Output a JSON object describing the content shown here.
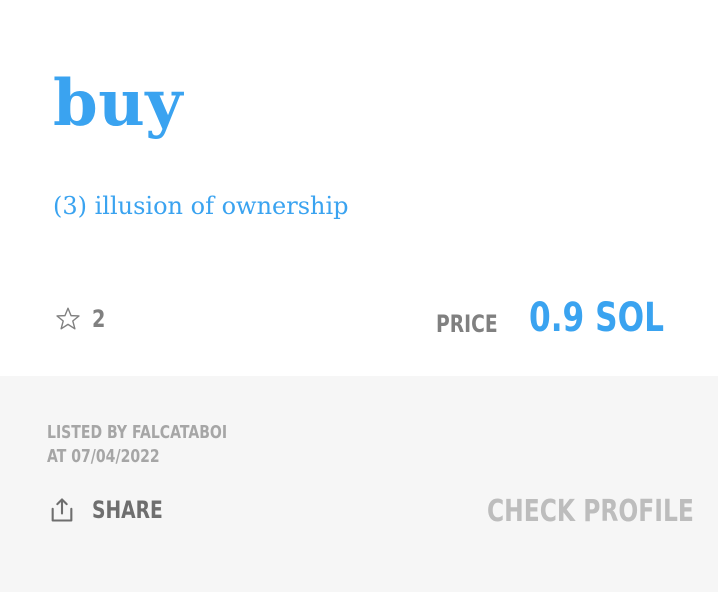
{
  "word": {
    "title": "buy",
    "definition": "(3) illusion of ownership"
  },
  "favorites": {
    "icon": "star-outline-icon",
    "count": "2"
  },
  "price": {
    "label": "PRICE",
    "value": "0.9 SOL"
  },
  "listing": {
    "listed_by": "LISTED BY FALCATABOI",
    "listed_at": "AT 07/04/2022"
  },
  "actions": {
    "share_icon": "share-icon",
    "share_label": "SHARE",
    "check_profile_label": "CHECK PROFILE"
  },
  "colors": {
    "accent": "#3aa3f0",
    "muted_text": "#808080",
    "footer_bg": "#f6f6f6",
    "footer_text": "#a6a6a6"
  }
}
